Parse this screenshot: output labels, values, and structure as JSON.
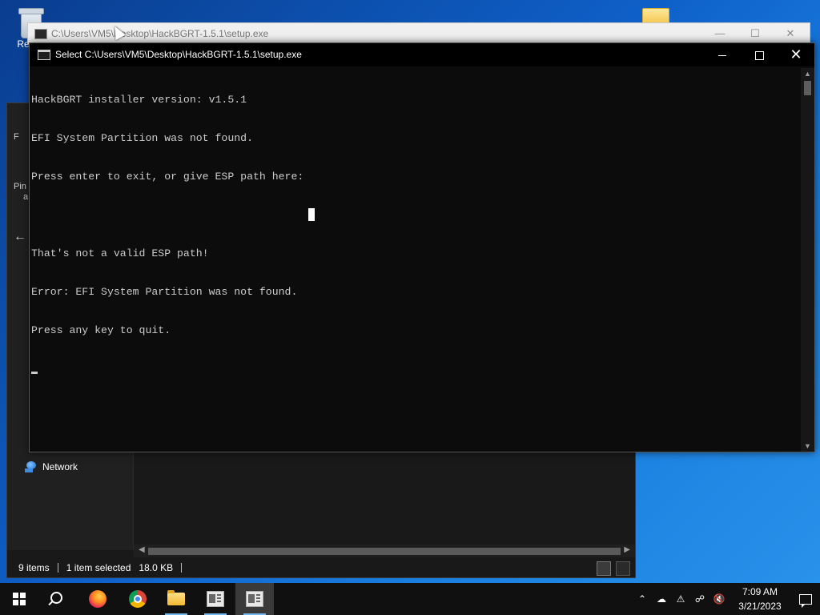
{
  "desktop": {
    "recycle_label": "Recyc"
  },
  "explorer": {
    "sidebar_partial": [
      "F",
      "Pin",
      "a"
    ],
    "network_label": "Network",
    "status_items": "9 items",
    "status_selected": "1 item selected",
    "status_size": "18.0 KB"
  },
  "bg_console": {
    "title": "C:\\Users\\VM5\\Desktop\\HackBGRT-1.5.1\\setup.exe"
  },
  "console": {
    "title": "Select C:\\Users\\VM5\\Desktop\\HackBGRT-1.5.1\\setup.exe",
    "lines": [
      "HackBGRT installer version: v1.5.1",
      "EFI System Partition was not found.",
      "Press enter to exit, or give ESP path here:",
      "",
      "That's not a valid ESP path!",
      "Error: EFI System Partition was not found.",
      "Press any key to quit."
    ]
  },
  "taskbar": {
    "apps": [
      "start",
      "search",
      "firefox",
      "chrome",
      "file-explorer",
      "console-app",
      "console-app-active"
    ],
    "time": "7:09 AM",
    "date": "3/21/2023"
  }
}
